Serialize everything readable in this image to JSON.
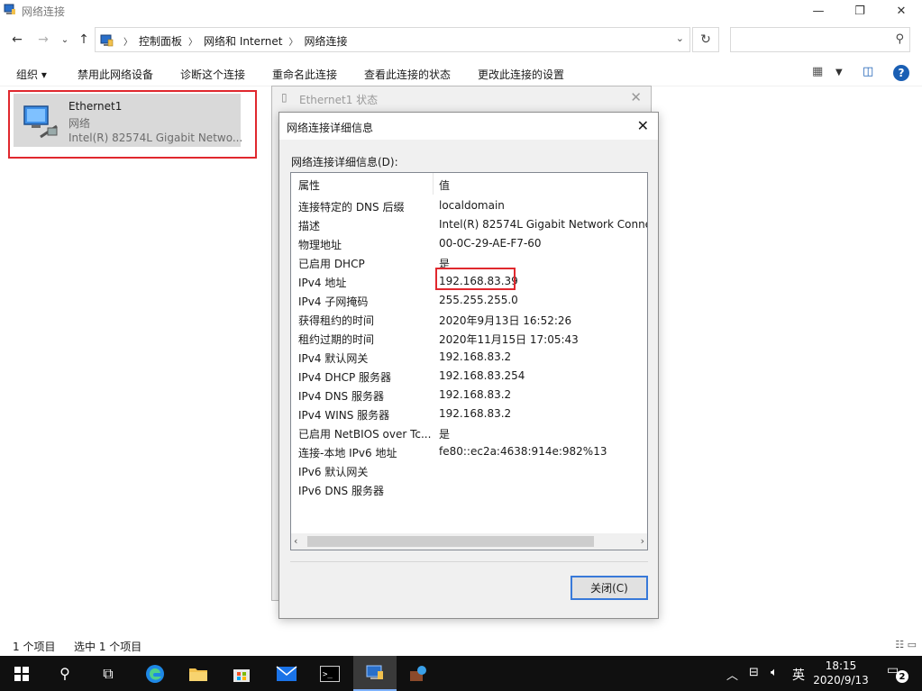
{
  "window": {
    "title": "网络连接"
  },
  "address": {
    "crumbs": [
      "控制面板",
      "网络和 Internet",
      "网络连接"
    ],
    "search_placeholder": ""
  },
  "commands": {
    "organize": "组织 ▾",
    "disable": "禁用此网络设备",
    "diagnose": "诊断这个连接",
    "rename": "重命名此连接",
    "status": "查看此连接的状态",
    "settings": "更改此连接的设置"
  },
  "connection": {
    "name": "Ethernet1",
    "network": "网络",
    "device": "Intel(R) 82574L Gigabit Netwo..."
  },
  "status_bar": {
    "count": "1 个项目",
    "selected": "选中 1 个项目"
  },
  "status_dialog": {
    "title": "Ethernet1 状态"
  },
  "details_dialog": {
    "title": "网络连接详细信息",
    "label": "网络连接详细信息(D):",
    "col_property": "属性",
    "col_value": "值",
    "rows": [
      {
        "p": "连接特定的 DNS 后缀",
        "v": "localdomain"
      },
      {
        "p": "描述",
        "v": "Intel(R) 82574L Gigabit Network Connec"
      },
      {
        "p": "物理地址",
        "v": "00-0C-29-AE-F7-60"
      },
      {
        "p": "已启用 DHCP",
        "v": "是"
      },
      {
        "p": "IPv4 地址",
        "v": "192.168.83.39"
      },
      {
        "p": "IPv4 子网掩码",
        "v": "255.255.255.0"
      },
      {
        "p": "获得租约的时间",
        "v": "2020年9月13日 16:52:26"
      },
      {
        "p": "租约过期的时间",
        "v": "2020年11月15日 17:05:43"
      },
      {
        "p": "IPv4 默认网关",
        "v": "192.168.83.2"
      },
      {
        "p": "IPv4 DHCP 服务器",
        "v": "192.168.83.254"
      },
      {
        "p": "IPv4 DNS 服务器",
        "v": "192.168.83.2"
      },
      {
        "p": "IPv4 WINS 服务器",
        "v": "192.168.83.2"
      },
      {
        "p": "已启用 NetBIOS over Tc...",
        "v": "是"
      },
      {
        "p": "连接-本地 IPv6 地址",
        "v": "fe80::ec2a:4638:914e:982%13"
      },
      {
        "p": "IPv6 默认网关",
        "v": ""
      },
      {
        "p": "IPv6 DNS 服务器",
        "v": ""
      }
    ],
    "close_label": "关闭(C)"
  },
  "taskbar": {
    "ime": "英",
    "time": "18:15",
    "date": "2020/9/13",
    "notifications": "2"
  },
  "colors": {
    "highlight": "#e0282e",
    "accent": "#3879d9",
    "taskbar": "#101010"
  }
}
